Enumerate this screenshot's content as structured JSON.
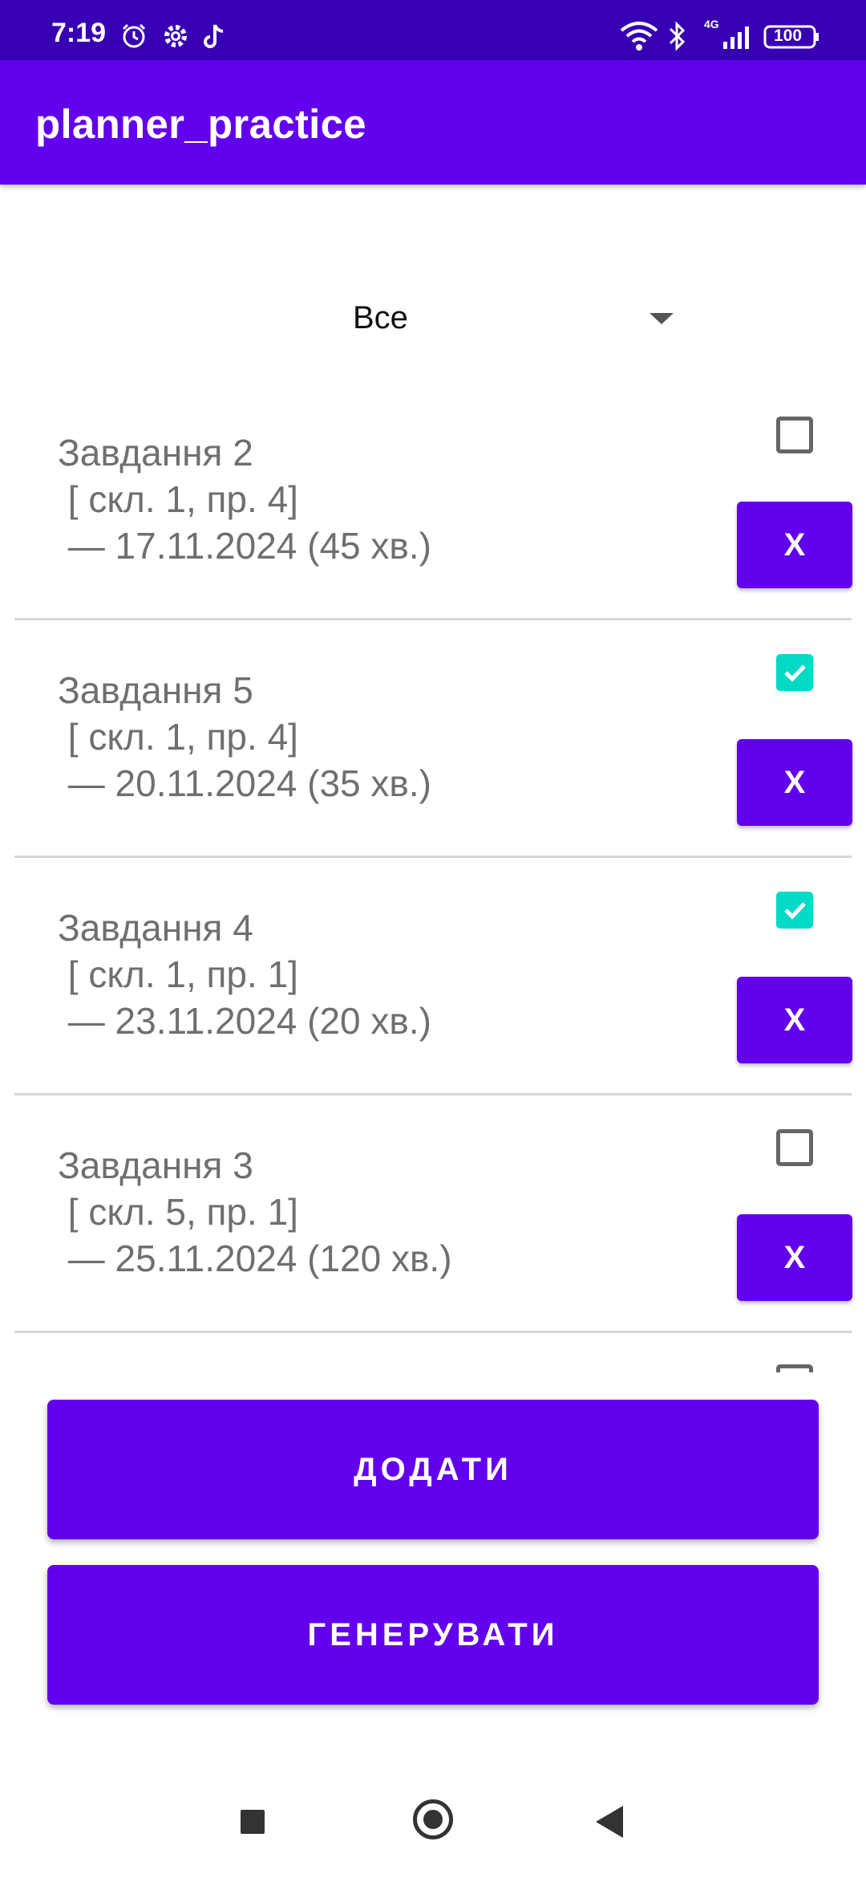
{
  "status_bar": {
    "time": "7:19",
    "battery": "100",
    "network": "4G",
    "icons": [
      "alarm-icon",
      "gear-icon",
      "tiktok-icon",
      "wifi-icon",
      "bluetooth-icon",
      "signal-icon",
      "battery-icon"
    ]
  },
  "app_bar": {
    "title": "planner_practice"
  },
  "filter": {
    "selected": "Все"
  },
  "tasks": [
    {
      "title": "Завдання 2",
      "meta": " [ скл. 1, пр. 4]",
      "due": " — 17.11.2024 (45 хв.)",
      "checked": false,
      "delete_label": "X"
    },
    {
      "title": "Завдання 5",
      "meta": " [ скл. 1, пр. 4]",
      "due": " — 20.11.2024 (35 хв.)",
      "checked": true,
      "delete_label": "X"
    },
    {
      "title": "Завдання 4",
      "meta": " [ скл. 1, пр. 1]",
      "due": " — 23.11.2024 (20 хв.)",
      "checked": true,
      "delete_label": "X"
    },
    {
      "title": "Завдання 3",
      "meta": " [ скл. 5, пр. 1]",
      "due": " — 25.11.2024 (120 хв.)",
      "checked": false,
      "delete_label": "X"
    }
  ],
  "buttons": {
    "add": "ДОДАТИ",
    "generate": "ГЕНЕРУВАТИ"
  },
  "colors": {
    "primary": "#6200ee",
    "primary_dark": "#3700b3",
    "accent": "#03dac5"
  }
}
